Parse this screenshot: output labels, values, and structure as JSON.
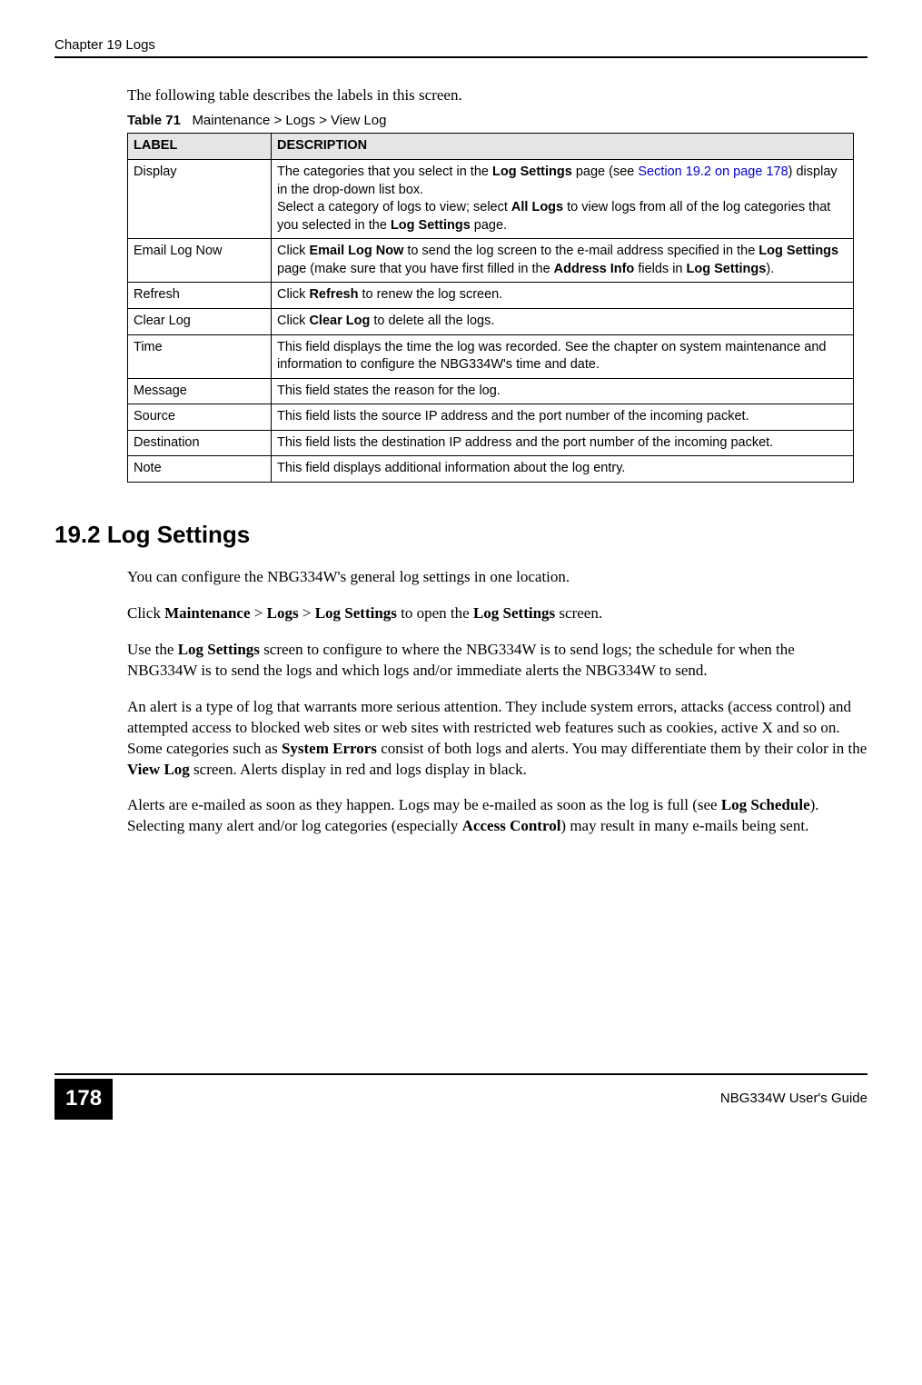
{
  "header": {
    "chapter": "Chapter 19 Logs"
  },
  "intro": "The following table describes the labels in this screen.",
  "table": {
    "number": "Table 71",
    "caption": "Maintenance > Logs > View Log",
    "headers": {
      "label": "LABEL",
      "desc": "DESCRIPTION"
    },
    "rows": {
      "display": {
        "label": "Display",
        "desc_pre": "The categories that you select in the ",
        "desc_b1": "Log Settings",
        "desc_mid1": " page (see ",
        "desc_link": "Section 19.2 on page 178",
        "desc_mid2": ") display in the drop-down list box.",
        "desc_line2_pre": "Select a category of logs to view; select ",
        "desc_b2": "All Logs",
        "desc_line2_mid": " to view logs from all of the log categories that you selected in the ",
        "desc_b3": "Log Settings",
        "desc_line2_end": " page."
      },
      "email": {
        "label": "Email Log Now",
        "pre": "Click ",
        "b1": "Email Log Now",
        "mid1": " to send the log screen to the e-mail address specified in the ",
        "b2": "Log Settings",
        "mid2": " page (make sure that you have first filled in the ",
        "b3": "Address Info",
        "mid3": " fields in ",
        "b4": "Log Settings",
        "end": ")."
      },
      "refresh": {
        "label": "Refresh",
        "pre": "Click ",
        "b1": "Refresh",
        "end": " to renew the log screen."
      },
      "clear": {
        "label": "Clear Log",
        "pre": "Click ",
        "b1": "Clear Log",
        "end": " to delete all the logs."
      },
      "time": {
        "label": "Time",
        "text": "This field displays the time the log was recorded. See the chapter on system maintenance and information to configure the NBG334W's time and date."
      },
      "message": {
        "label": "Message",
        "text": "This field states the reason for the log."
      },
      "source": {
        "label": "Source",
        "text": "This field lists the source IP address and the port number of the incoming packet."
      },
      "destination": {
        "label": "Destination",
        "text": "This field lists the destination IP address and the port number of the incoming packet."
      },
      "note": {
        "label": "Note",
        "text": "This field displays additional information about the log entry."
      }
    }
  },
  "section": {
    "heading": "19.2  Log Settings",
    "p1": "You can configure the NBG334W's general log settings in one location.",
    "p2_pre": "Click ",
    "p2_b1": "Maintenance",
    "p2_gt1": " > ",
    "p2_b2": "Logs",
    "p2_gt2": " > ",
    "p2_b3": "Log Settings",
    "p2_mid": " to open the ",
    "p2_b4": "Log Settings",
    "p2_end": " screen.",
    "p3_pre": "Use the ",
    "p3_b1": "Log Settings",
    "p3_end": " screen to configure to where the NBG334W is to send logs; the schedule for when the NBG334W is to send the logs and which logs and/or immediate alerts the NBG334W to send.",
    "p4_pre": "An alert is a type of log that warrants more serious attention. They include system errors, attacks (access control) and attempted access to blocked web sites or web sites with restricted web features such as cookies, active X and so on. Some categories such as ",
    "p4_b1": "System Errors",
    "p4_mid": " consist of both logs and alerts. You may differentiate them by their color in the ",
    "p4_b2": "View Log",
    "p4_end": " screen. Alerts display in red and logs display in black.",
    "p5_pre": "Alerts are e-mailed as soon as they happen. Logs may be e-mailed as soon as the log is full (see ",
    "p5_b1": "Log Schedule",
    "p5_mid": "). Selecting many alert and/or log categories (especially ",
    "p5_b2": "Access Control",
    "p5_end": ") may result in many e-mails being sent."
  },
  "footer": {
    "page": "178",
    "guide": "NBG334W User's Guide"
  }
}
